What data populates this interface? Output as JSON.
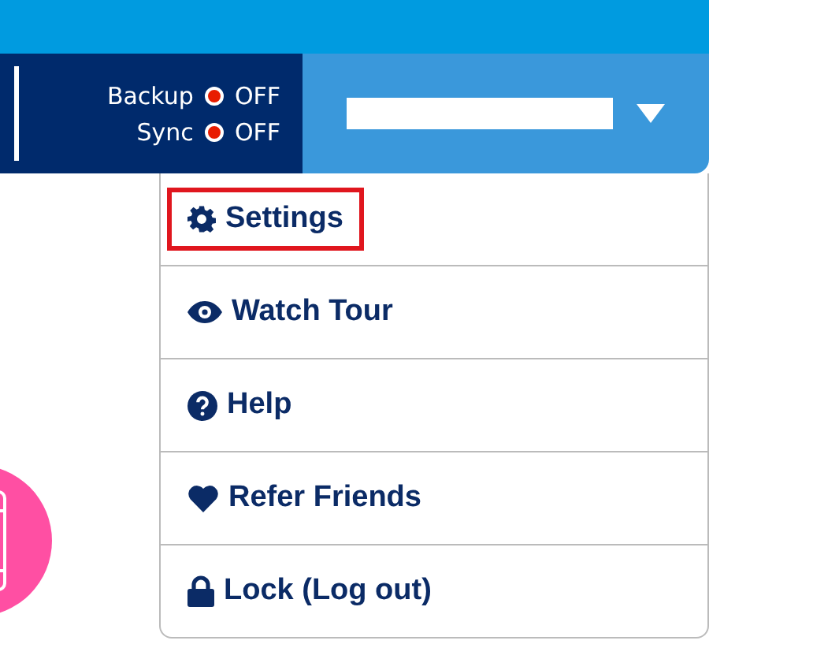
{
  "status": [
    {
      "label": "Backup",
      "state": "OFF",
      "on": false
    },
    {
      "label": "Sync",
      "state": "OFF",
      "on": false
    }
  ],
  "account": {
    "redacted": true,
    "expanded": true
  },
  "menu": [
    {
      "kind": "gear",
      "label": "Settings",
      "highlighted": true
    },
    {
      "kind": "eye",
      "label": "Watch Tour",
      "highlighted": false
    },
    {
      "kind": "help",
      "label": "Help",
      "highlighted": false
    },
    {
      "kind": "heart",
      "label": "Refer Friends",
      "highlighted": false
    },
    {
      "kind": "lock",
      "label": "Lock (Log out)",
      "highlighted": false
    }
  ]
}
